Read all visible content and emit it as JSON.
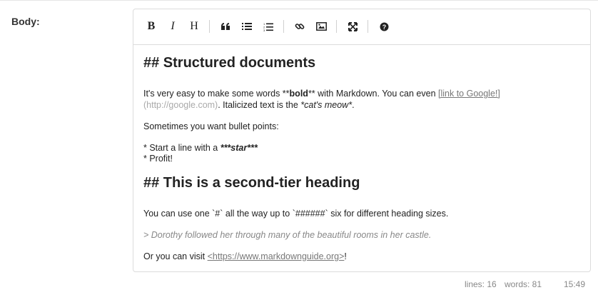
{
  "field": {
    "label": "Body:"
  },
  "toolbar": {
    "bold": "B",
    "italic": "I",
    "heading": "H"
  },
  "doc": {
    "h1": "## Structured documents",
    "p1_a": "It's very easy to make some words **",
    "p1_bold": "bold",
    "p1_b": "** with Markdown. You can even ",
    "p1_link": "[link to Google!]",
    "p2_url": "(http://google.com)",
    "p2_a": ". Italicized text is the ",
    "p2_italic": "*cat's meow*",
    "p2_b": ".",
    "p3": "Sometimes you want bullet points:",
    "li1_a": "* Start a line with a ",
    "li1_star": "***star***",
    "li2": "* Profit!",
    "h2": "## This is a second-tier heading",
    "p4": "You can use one `#` all the way up to `######` six for different heading sizes.",
    "quote": "> Dorothy followed her through many of the beautiful rooms in her castle.",
    "p5_a": "Or you can visit ",
    "p5_link": "<https://www.markdownguide.org>",
    "p5_b": "!"
  },
  "status": {
    "lines": "lines: 16",
    "words": "words: 81",
    "cursor": "15:49"
  }
}
